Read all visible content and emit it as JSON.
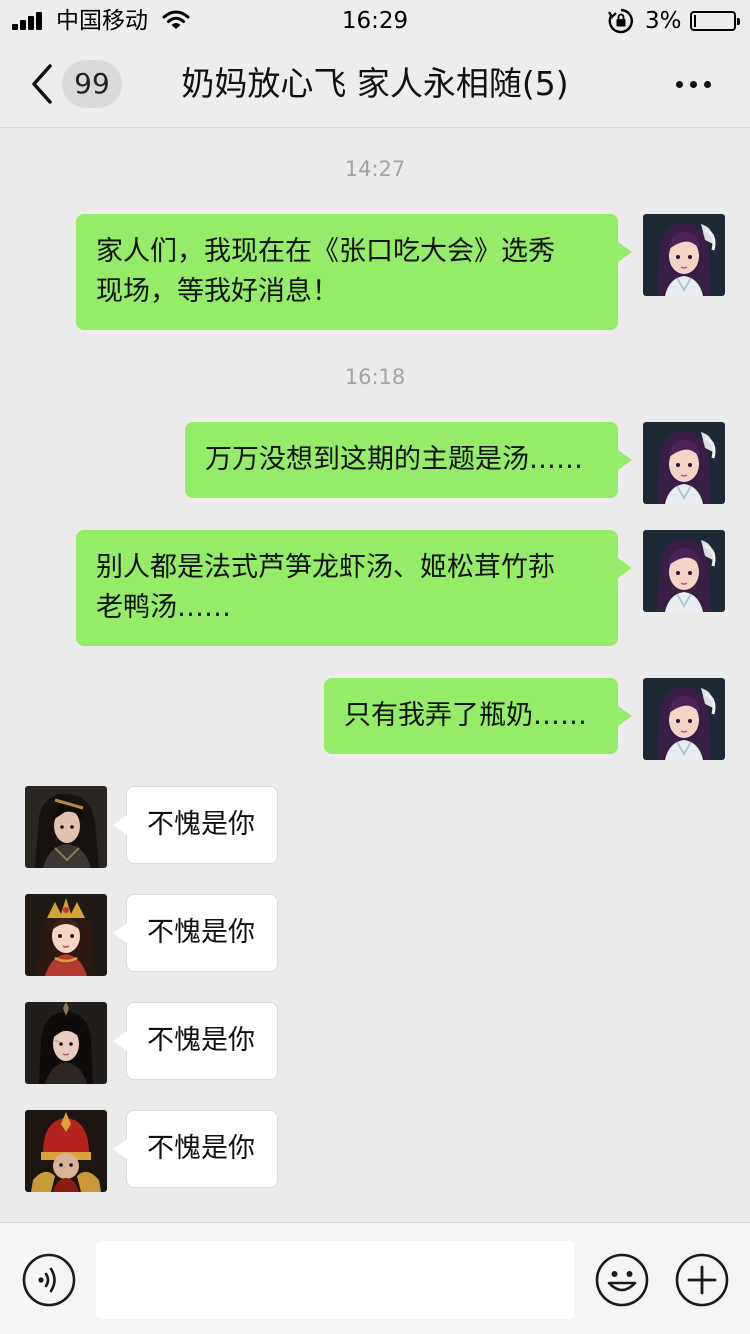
{
  "status_bar": {
    "carrier": "中国移动",
    "time": "16:29",
    "battery_percent": "3%",
    "battery_level": 0.03
  },
  "nav": {
    "unread_count": "99",
    "title": "奶妈放心飞 家人永相随(5)"
  },
  "messages": [
    {
      "type": "time",
      "text": "14:27"
    },
    {
      "type": "out",
      "text": "家人们，我现在在《张口吃大会》选秀\n现场，等我好消息！",
      "avatar": "avatar-female-purple-hair"
    },
    {
      "type": "time",
      "text": "16:18"
    },
    {
      "type": "out",
      "text": "万万没想到这期的主题是汤……",
      "avatar": "avatar-female-purple-hair"
    },
    {
      "type": "out",
      "text": "别人都是法式芦笋龙虾汤、姬松茸竹荪\n老鸭汤……",
      "avatar": "avatar-female-purple-hair"
    },
    {
      "type": "out",
      "text": "只有我弄了瓶奶……",
      "avatar": "avatar-female-purple-hair"
    },
    {
      "type": "in",
      "text": "不愧是你",
      "avatar": "avatar-male-dark-swordsman"
    },
    {
      "type": "in",
      "text": "不愧是你",
      "avatar": "avatar-female-gold-crown"
    },
    {
      "type": "in",
      "text": "不愧是你",
      "avatar": "avatar-male-dark-hair"
    },
    {
      "type": "in",
      "text": "不愧是你",
      "avatar": "avatar-red-helmet-warrior"
    }
  ],
  "input": {
    "placeholder": ""
  },
  "icons": {
    "signal": "signal-bars-icon",
    "wifi": "wifi-icon",
    "rotation_lock": "rotation-lock-icon",
    "back": "chevron-left-icon",
    "more": "more-dots-icon",
    "voice": "voice-icon",
    "emoji": "emoji-icon",
    "plus": "plus-circle-icon"
  },
  "colors": {
    "outgoing_bubble": "#95ec69",
    "incoming_bubble": "#ffffff",
    "background": "#ebebeb",
    "timestamp": "#a3a3a3"
  }
}
